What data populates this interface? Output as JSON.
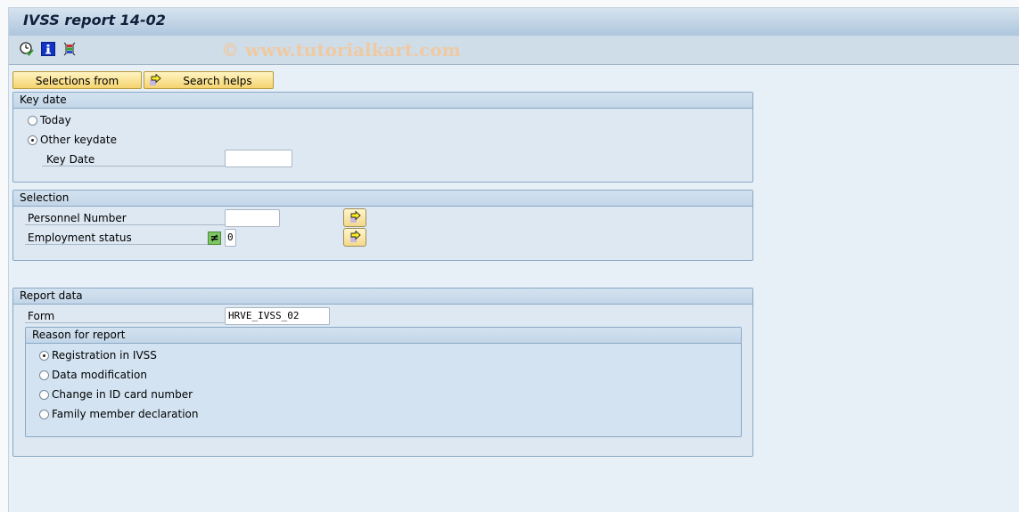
{
  "window": {
    "title": "IVSS report 14-02",
    "watermark": "© www.tutorialkart.com"
  },
  "toolbar": {
    "icons": [
      "execute-clock-icon",
      "info-icon",
      "layout-icon"
    ]
  },
  "buttons": {
    "selections_from": "Selections from",
    "search_helps": "Search helps"
  },
  "key_date_group": {
    "title": "Key date",
    "options": [
      {
        "label": "Today",
        "checked": false
      },
      {
        "label": "Other keydate",
        "checked": true
      }
    ],
    "key_date_label": "Key Date",
    "key_date_value": ""
  },
  "selection_group": {
    "title": "Selection",
    "personnel_number_label": "Personnel Number",
    "personnel_number_value": "",
    "employment_status_label": "Employment status",
    "employment_status_operator": "≠",
    "employment_status_value": "0"
  },
  "report_data_group": {
    "title": "Report data",
    "form_label": "Form",
    "form_value": "HRVE_IVSS_02",
    "reason_group": {
      "title": "Reason for report",
      "options": [
        {
          "label": "Registration in IVSS",
          "checked": true
        },
        {
          "label": "Data modification",
          "checked": false
        },
        {
          "label": "Change in ID card number",
          "checked": false
        },
        {
          "label": "Family member declaration",
          "checked": false
        }
      ]
    }
  }
}
